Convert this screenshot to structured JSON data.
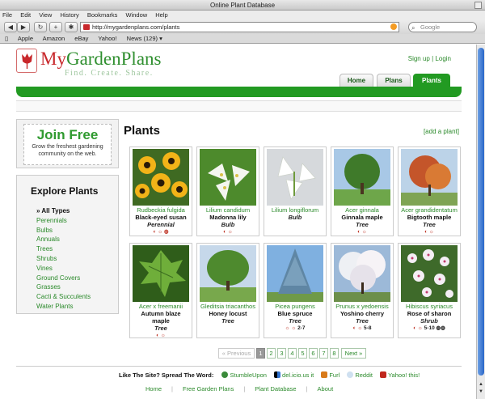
{
  "window": {
    "title": "Online Plant Database"
  },
  "menu": [
    "File",
    "Edit",
    "View",
    "History",
    "Bookmarks",
    "Window",
    "Help"
  ],
  "toolbar": {
    "url": "http://mygardenplans.com/plants",
    "search_placeholder": "Google",
    "back_icon": "arrow-left-icon",
    "forward_icon": "arrow-right-icon",
    "reload_icon": "reload-icon",
    "add_icon": "plus-icon",
    "bug_icon": "bug-icon"
  },
  "bookmarks": [
    "Apple",
    "Amazon",
    "eBay",
    "Yahoo!",
    "News (129) ▾"
  ],
  "brand": {
    "name_part1": "My",
    "name_part2": "GardenPlans",
    "tagline": "Find. Create. Share.",
    "accent": "#229a22",
    "red": "#c8282c"
  },
  "auth": {
    "signup": "Sign up",
    "separator": "|",
    "login": "Login"
  },
  "tabs": [
    {
      "label": "Home",
      "active": false
    },
    {
      "label": "Plans",
      "active": false
    },
    {
      "label": "Plants",
      "active": true
    }
  ],
  "join": {
    "title": "Join Free",
    "description": "Grow the freshest gardening community on the web."
  },
  "explore": {
    "title": "Explore Plants",
    "items": [
      "All Types",
      "Perennials",
      "Bulbs",
      "Annuals",
      "Trees",
      "Shrubs",
      "Vines",
      "Ground Covers",
      "Grasses",
      "Cacti & Succulents",
      "Water Plants"
    ],
    "selected": "All Types"
  },
  "main": {
    "title": "Plants",
    "add_link": "[add a plant]"
  },
  "plants": [
    {
      "scientific": "Rudbeckia fulgida",
      "common": "Black-eyed susan",
      "type": "Perennial",
      "icons": "◐ ☼ ◍",
      "zone": ""
    },
    {
      "scientific": "Lilium candidum",
      "common": "Madonna lily",
      "type": "Bulb",
      "icons": "◐ ☼",
      "zone": ""
    },
    {
      "scientific": "Lilium longiflorum",
      "common": "",
      "type": "Bulb",
      "icons": "",
      "zone": ""
    },
    {
      "scientific": "Acer ginnala",
      "common": "Ginnala maple",
      "type": "Tree",
      "icons": "◐ ☼",
      "zone": ""
    },
    {
      "scientific": "Acer grandidentatum",
      "common": "Bigtooth maple",
      "type": "Tree",
      "icons": "◐ ☼",
      "zone": ""
    },
    {
      "scientific": "Acer x freemanii",
      "common": "Autumn blaze maple",
      "type": "Tree",
      "icons": "◐ ☼",
      "zone": ""
    },
    {
      "scientific": "Gleditsia triacanthos",
      "common": "Honey locust",
      "type": "Tree",
      "icons": "",
      "zone": ""
    },
    {
      "scientific": "Picea pungens",
      "common": "Blue spruce",
      "type": "Tree",
      "icons": "☼ ☼",
      "zone": "2-7"
    },
    {
      "scientific": "Prunus x yedoensis",
      "common": "Yoshino cherry",
      "type": "Tree",
      "icons": "◐ ☼",
      "zone": "5-8"
    },
    {
      "scientific": "Hibiscus syriacus",
      "common": "Rose of sharon",
      "type": "Shrub",
      "icons": "◐ ☼",
      "zone": "5-10 ◍◍"
    }
  ],
  "pagination": {
    "prev": "« Previous",
    "pages": [
      "1",
      "2",
      "3",
      "4",
      "5",
      "6",
      "7",
      "8"
    ],
    "current": "1",
    "next": "Next »"
  },
  "share": {
    "label": "Like The Site? Spread The Word:",
    "services": [
      "StumbleUpon",
      "del.icio.us it",
      "Furl",
      "Reddit",
      "Yahoo! this!"
    ]
  },
  "footer": [
    "Home",
    "Free Garden Plans",
    "Plant Database",
    "About"
  ]
}
